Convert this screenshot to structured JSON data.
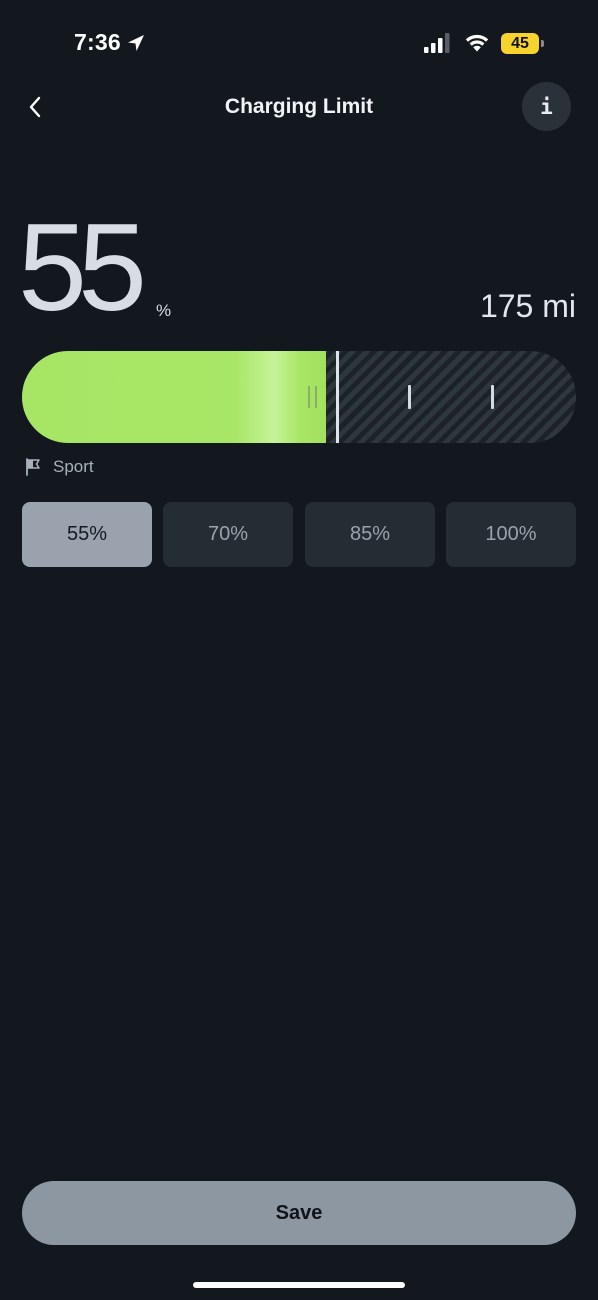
{
  "status_bar": {
    "time": "7:36",
    "battery_level": "45",
    "battery_color": "#f6d32d",
    "icons": [
      "location-arrow-icon",
      "cellular-signal-icon",
      "wifi-icon",
      "battery-icon"
    ]
  },
  "header": {
    "title": "Charging Limit",
    "back_icon": "chevron-left-icon",
    "info_label": "i"
  },
  "charge": {
    "value": "55",
    "unit": "%",
    "range": "175 mi",
    "level_fraction": 0.55,
    "fill_color": "#a8e667",
    "tick_positions_fraction": [
      0.7,
      0.85
    ]
  },
  "mode": {
    "icon": "flag-icon",
    "label": "Sport"
  },
  "presets": [
    {
      "label": "55%",
      "selected": true
    },
    {
      "label": "70%",
      "selected": false
    },
    {
      "label": "85%",
      "selected": false
    },
    {
      "label": "100%",
      "selected": false
    }
  ],
  "save_label": "Save",
  "colors": {
    "background": "#13181e",
    "accent_green": "#a8e667",
    "selected_preset": "#99a2ad",
    "save_button": "#8c97a2"
  }
}
